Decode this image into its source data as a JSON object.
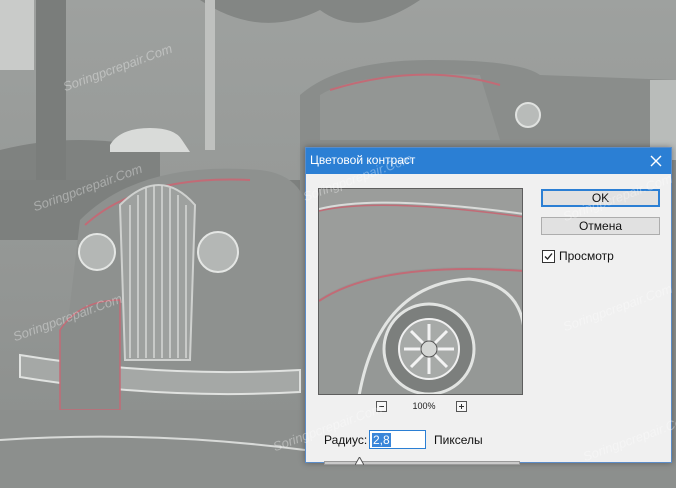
{
  "dialog": {
    "title": "Цветовой контраст",
    "ok_label": "OK",
    "cancel_label": "Отмена",
    "preview_label": "Просмотр",
    "preview_checked": true,
    "zoom_value": "100%",
    "radius_label": "Радиус:",
    "radius_value": "2,8",
    "radius_unit": "Пикселы",
    "slider_position_fraction": 0.18
  },
  "watermark": "Soringpcrepair.Com",
  "colors": {
    "titlebar": "#2b7fd4",
    "dialog_bg": "#f0f0f0",
    "button_bg": "#e1e1e1",
    "selection": "#3a86d9"
  }
}
